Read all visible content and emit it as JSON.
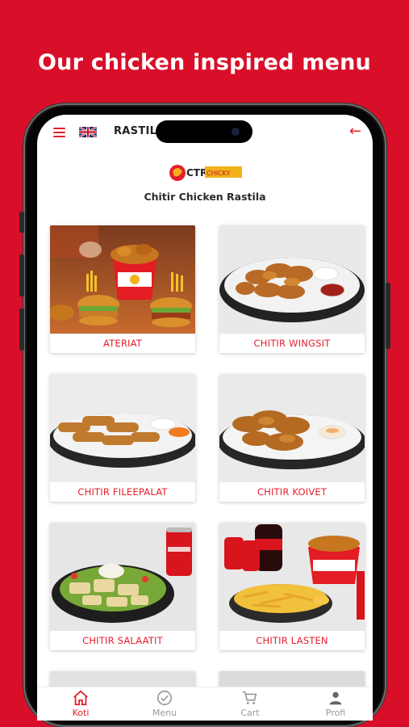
{
  "headline": "Our chicken inspired menu",
  "app": {
    "restaurant_name": "RASTILA  ·  ·  ·  ·  ·  ·  U",
    "logo_text": "CTR",
    "logo_tag": "CHICKY",
    "store_title": "Chitir Chicken Rastila"
  },
  "categories": [
    {
      "label": "ATERIAT"
    },
    {
      "label": "CHITIR WINGSIT"
    },
    {
      "label": "CHITIR FILEEPALAT"
    },
    {
      "label": "CHITIR KOIVET"
    },
    {
      "label": "CHITIR SALAATIT"
    },
    {
      "label": "CHITIR LASTEN"
    }
  ],
  "bottom_nav": [
    {
      "label": "Koti",
      "icon": "home-icon",
      "active": true
    },
    {
      "label": "Menu",
      "icon": "check-circle-icon",
      "active": false
    },
    {
      "label": "Cart",
      "icon": "cart-icon",
      "active": false
    },
    {
      "label": "Profi",
      "icon": "user-icon",
      "active": false
    }
  ],
  "colors": {
    "brand_red": "#d90f2a",
    "accent_red": "#e5202e",
    "nav_inactive": "#999999"
  }
}
